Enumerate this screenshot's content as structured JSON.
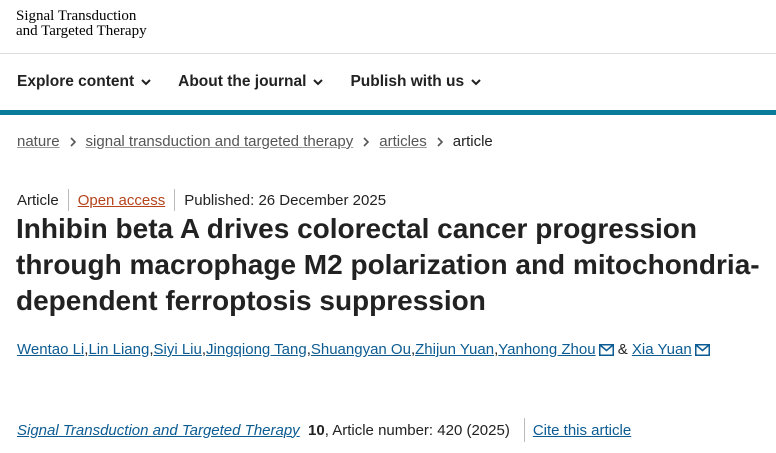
{
  "journal": {
    "logo_line1": "Signal Transduction",
    "logo_line2": "and Targeted Therapy"
  },
  "nav": {
    "items": [
      {
        "label": "Explore content"
      },
      {
        "label": "About the journal"
      },
      {
        "label": "Publish with us"
      }
    ]
  },
  "colors": {
    "accent": "#0a7b9b",
    "link": "#0c5c93",
    "open_access": "#b5441b"
  },
  "breadcrumb": {
    "items": [
      {
        "label": "nature"
      },
      {
        "label": "signal transduction and targeted therapy"
      },
      {
        "label": "articles"
      }
    ],
    "current": "article"
  },
  "article": {
    "type": "Article",
    "open_access": "Open access",
    "published": "Published: 26 December 2025",
    "title": "Inhibin beta A drives colorectal cancer progression through macrophage M2 polarization and mitochondria-dependent ferroptosis suppression",
    "authors": [
      "Wentao Li",
      "Lin Liang",
      "Siyi Liu",
      "Jingqiong Tang",
      "Shuangyan Ou",
      "Zhijun Yuan",
      "Yanhong Zhou",
      "Xia Yuan"
    ],
    "author_sep": ", ",
    "author_and": " & "
  },
  "citation": {
    "journal": "Signal Transduction and Targeted Therapy",
    "volume": "10",
    "rest": ", Article number: 420 (2025)",
    "cite_label": "Cite this article"
  }
}
